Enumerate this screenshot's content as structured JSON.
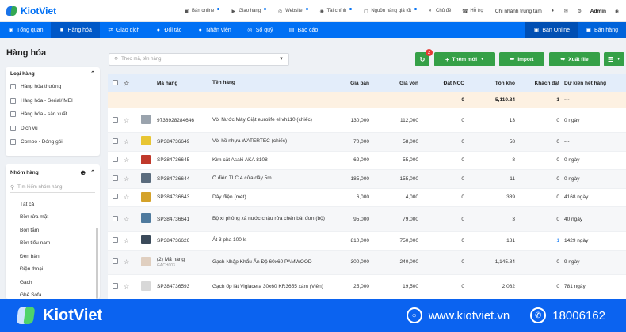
{
  "app": {
    "name": "KiotViet"
  },
  "topbar": {
    "links": [
      {
        "label": "Bán online",
        "icon": "shop-icon",
        "dot": true
      },
      {
        "label": "Giao hàng",
        "icon": "truck-icon",
        "dot": true
      },
      {
        "label": "Website",
        "icon": "globe-icon",
        "dot": true
      },
      {
        "label": "Tài chính",
        "icon": "finance-icon",
        "dot": true
      },
      {
        "label": "Nguồn hàng giá tốt",
        "icon": "box-icon",
        "dot": true
      },
      {
        "label": "Chủ đề",
        "icon": "theme-icon",
        "dot": false
      },
      {
        "label": "Hỗ trợ",
        "icon": "support-icon",
        "dot": false
      }
    ],
    "branch": "Chi nhánh trung tâm",
    "user": "Admin"
  },
  "nav": {
    "items": [
      {
        "label": "Tổng quan",
        "icon": "eye-icon",
        "active": false
      },
      {
        "label": "Hàng hóa",
        "icon": "cube-icon",
        "active": true
      },
      {
        "label": "Giao dịch",
        "icon": "transfer-icon",
        "active": false
      },
      {
        "label": "Đối tác",
        "icon": "person-icon",
        "active": false
      },
      {
        "label": "Nhân viên",
        "icon": "team-icon",
        "active": false
      },
      {
        "label": "Sổ quỹ",
        "icon": "cash-icon",
        "active": false
      },
      {
        "label": "Báo cáo",
        "icon": "chart-icon",
        "active": false
      }
    ],
    "right": [
      {
        "label": "Bán Online",
        "icon": "store-icon"
      },
      {
        "label": "Bán hàng",
        "icon": "cart-icon"
      }
    ]
  },
  "page_title": "Hàng hóa",
  "type_filter": {
    "title": "Loại hàng",
    "options": [
      "Hàng hóa thường",
      "Hàng hóa - Serial/IMEI",
      "Hàng hóa - sản xuất",
      "Dịch vụ",
      "Combo - Đóng gói"
    ]
  },
  "group_filter": {
    "title": "Nhóm hàng",
    "search_placeholder": "Tìm kiếm nhóm hàng",
    "items": [
      "Tất cả",
      "Bồn rửa mặt",
      "Bồn tắm",
      "Bồn tiểu nam",
      "Đèn bàn",
      "Điện thoại",
      "Gạch",
      "Ghế Sofa"
    ]
  },
  "search": {
    "placeholder": "Theo mã, tên hàng"
  },
  "toolbar": {
    "refresh_badge": "2",
    "add_label": "Thêm mới",
    "import_label": "Import",
    "export_label": "Xuất file"
  },
  "table": {
    "headers": [
      "Mã hàng",
      "Tên hàng",
      "Giá bán",
      "Giá vốn",
      "Đặt NCC",
      "Tồn kho",
      "Khách đặt",
      "Dự kiến hết hàng"
    ],
    "summary": {
      "ncc": "0",
      "stock": "5,110.84",
      "customer": "1",
      "expected": "---"
    },
    "rows": [
      {
        "code": "9738928284646",
        "name": "Vòi Nước Máy Giặt eurolife el vh110 (chiếc)",
        "price": "130,000",
        "cost": "112,000",
        "ncc": "0",
        "stock": "13",
        "customer": "0",
        "expected": "0 ngày",
        "thumb": "#9aa3ad"
      },
      {
        "code": "SP384736649",
        "name": "Vòi hồ nhựa WATERTEC (chiếc)",
        "price": "70,000",
        "cost": "58,000",
        "ncc": "0",
        "stock": "58",
        "customer": "0",
        "expected": "---",
        "thumb": "#e8c533"
      },
      {
        "code": "SP384736645",
        "name": "Kìm cắt Asaki AKA 8108",
        "price": "62,000",
        "cost": "55,000",
        "ncc": "0",
        "stock": "8",
        "customer": "0",
        "expected": "0 ngày",
        "thumb": "#c0392b"
      },
      {
        "code": "SP384736644",
        "name": "Ổ điện TLC 4 cửa dây 5m",
        "price": "185,000",
        "cost": "155,000",
        "ncc": "0",
        "stock": "11",
        "customer": "0",
        "expected": "0 ngày",
        "thumb": "#5a6b7d"
      },
      {
        "code": "SP384736643",
        "name": "Dây điện (mét)",
        "price": "6,000",
        "cost": "4,000",
        "ncc": "0",
        "stock": "389",
        "customer": "0",
        "expected": "4168 ngày",
        "thumb": "#d4a22a"
      },
      {
        "code": "SP384736641",
        "name": "Bộ xì phông xả nước chậu rửa chén bát đơn (bộ)",
        "price": "95,000",
        "cost": "79,000",
        "ncc": "0",
        "stock": "3",
        "customer": "0",
        "expected": "40 ngày",
        "thumb": "#4f7a9e"
      },
      {
        "code": "SP384736626",
        "name": "Át 3 pha 100 ls",
        "price": "810,000",
        "cost": "750,000",
        "ncc": "0",
        "stock": "181",
        "customer": "1",
        "expected": "1429 ngày",
        "thumb": "#3b4a5a"
      },
      {
        "code": "(2) Mã hàng",
        "code_sub": "GACH003...",
        "name": "Gạch Nhập Khẩu Ấn Độ 60x60 PAMWOOD",
        "price": "300,000",
        "cost": "240,000",
        "ncc": "0",
        "stock": "1,145.84",
        "customer": "0",
        "expected": "9 ngày",
        "thumb": "#e0cfc0"
      },
      {
        "code": "SP384736593",
        "name": "Gạch ốp lát Viglacera 30x60 KR3655 xám (Viên)",
        "price": "25,000",
        "cost": "19,500",
        "ncc": "0",
        "stock": "2,082",
        "customer": "0",
        "expected": "781 ngày",
        "thumb": "#d8d8d8"
      }
    ]
  },
  "footer": {
    "brand": "KiotViet",
    "website": "www.kiotviet.vn",
    "phone": "18006162"
  },
  "colors": {
    "primary": "#0070f4",
    "green": "#35a047",
    "footer": "#0b63f0",
    "summary_bg": "#fdf1e2",
    "header_bg": "#e3edfa"
  }
}
